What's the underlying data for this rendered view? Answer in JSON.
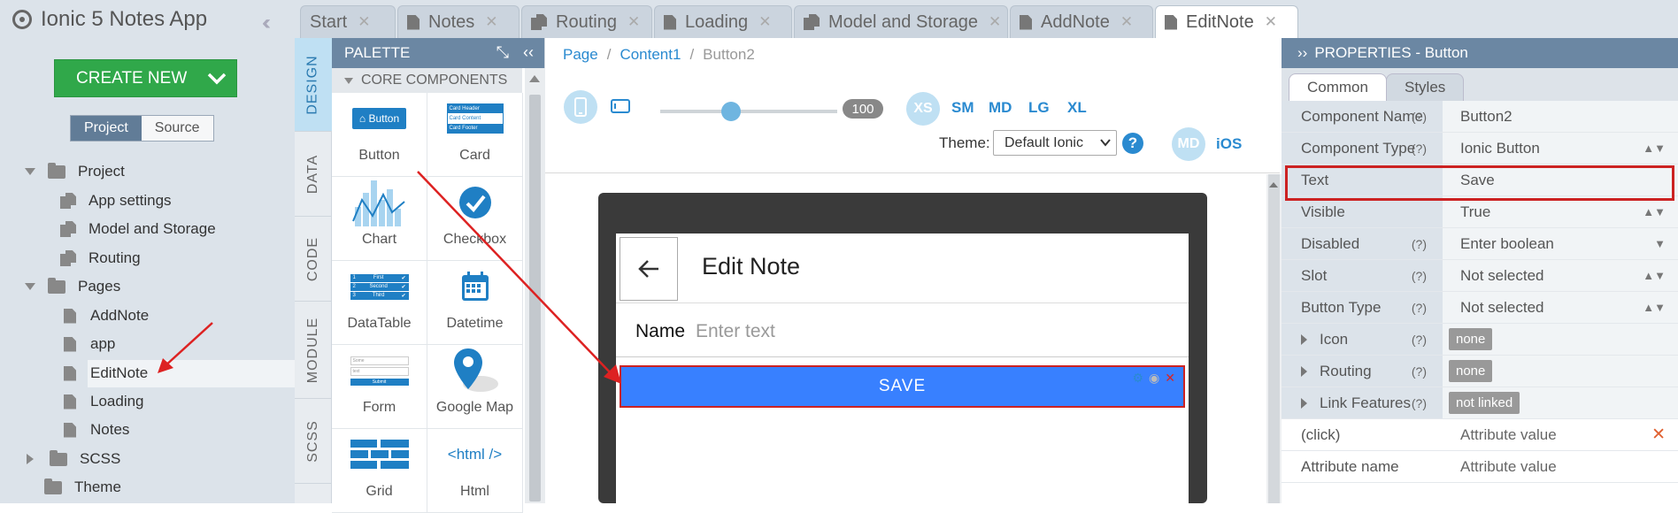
{
  "app": {
    "title": "Ionic 5 Notes App",
    "collapse_icon": "double-chevron-left-icon"
  },
  "sidebar": {
    "create_new": "CREATE NEW",
    "view_toggle": {
      "project": "Project",
      "source": "Source",
      "active": "Project"
    },
    "tree": [
      {
        "label": "Project",
        "kind": "folder",
        "expanded": true
      },
      {
        "label": "App settings",
        "kind": "files"
      },
      {
        "label": "Model and Storage",
        "kind": "files"
      },
      {
        "label": "Routing",
        "kind": "files"
      },
      {
        "label": "Pages",
        "kind": "folder",
        "expanded": true
      },
      {
        "label": "AddNote",
        "kind": "file"
      },
      {
        "label": "app",
        "kind": "file"
      },
      {
        "label": "EditNote",
        "kind": "file",
        "selected": true
      },
      {
        "label": "Loading",
        "kind": "file"
      },
      {
        "label": "Notes",
        "kind": "file"
      },
      {
        "label": "SCSS",
        "kind": "folder",
        "expanded": false
      },
      {
        "label": "Theme",
        "kind": "folder"
      }
    ]
  },
  "tabs": [
    {
      "label": "Start",
      "closable": true
    },
    {
      "label": "Notes",
      "closable": true
    },
    {
      "label": "Routing",
      "closable": true
    },
    {
      "label": "Loading",
      "closable": true
    },
    {
      "label": "Model and Storage",
      "closable": true
    },
    {
      "label": "AddNote",
      "closable": true
    },
    {
      "label": "EditNote",
      "closable": true,
      "active": true
    }
  ],
  "vertical_tabs": [
    "DESIGN",
    "DATA",
    "CODE",
    "MODULE",
    "SCSS"
  ],
  "palette": {
    "title": "PALETTE",
    "section": "CORE COMPONENTS",
    "items": [
      "Button",
      "Card",
      "Chart",
      "Checkbox",
      "DataTable",
      "Datetime",
      "Form",
      "Google Map",
      "Grid",
      "<html />"
    ],
    "button_preview": "Button",
    "card_preview": [
      "Card Header",
      "Card Content",
      "Card Footer"
    ],
    "datatable_preview": [
      "First",
      "Second",
      "Third"
    ],
    "form_preview": [
      "Some",
      "text",
      "Submit"
    ]
  },
  "breadcrumb": [
    "Page",
    "Content1",
    "Button2"
  ],
  "canvas": {
    "zoom": "100",
    "zoom_fraction": 0.4,
    "breakpoints": [
      "XS",
      "SM",
      "MD",
      "LG",
      "XL"
    ],
    "active_breakpoint": "XS",
    "theme_label": "Theme:",
    "theme_value": "Default Ionic",
    "platforms": [
      "MD",
      "iOS"
    ],
    "active_platform": "MD"
  },
  "preview": {
    "page_title": "Edit Note",
    "name_label": "Name",
    "name_placeholder": "Enter text",
    "save_button": "SAVE"
  },
  "properties": {
    "title": "PROPERTIES - Button",
    "tabs": [
      "Common",
      "Styles"
    ],
    "active_tab": "Common",
    "rows": [
      {
        "key": "Component Name",
        "help": "(?)",
        "value": "Button2"
      },
      {
        "key": "Component Type",
        "help": "(?)",
        "value": "Ionic Button"
      },
      {
        "key": "Text",
        "help": "",
        "value": "Save"
      },
      {
        "key": "Visible",
        "help": "",
        "value": "True"
      },
      {
        "key": "Disabled",
        "help": "(?)",
        "value": "Enter boolean"
      },
      {
        "key": "Slot",
        "help": "(?)",
        "value": "Not selected"
      },
      {
        "key": "Button Type",
        "help": "(?)",
        "value": "Not selected"
      },
      {
        "key": "Icon",
        "help": "(?)",
        "value": "none"
      },
      {
        "key": "Routing",
        "help": "(?)",
        "value": "none"
      },
      {
        "key": "Link Features",
        "help": "(?)",
        "value": "not linked"
      },
      {
        "key": "(click)",
        "help": "",
        "value": "Attribute value"
      },
      {
        "key": "Attribute name",
        "help": "",
        "value": "Attribute value"
      }
    ]
  },
  "colors": {
    "accent": "#2a8ad0",
    "create": "#30a84a",
    "ionic_primary": "#3880ff",
    "highlight": "#cc2222"
  }
}
